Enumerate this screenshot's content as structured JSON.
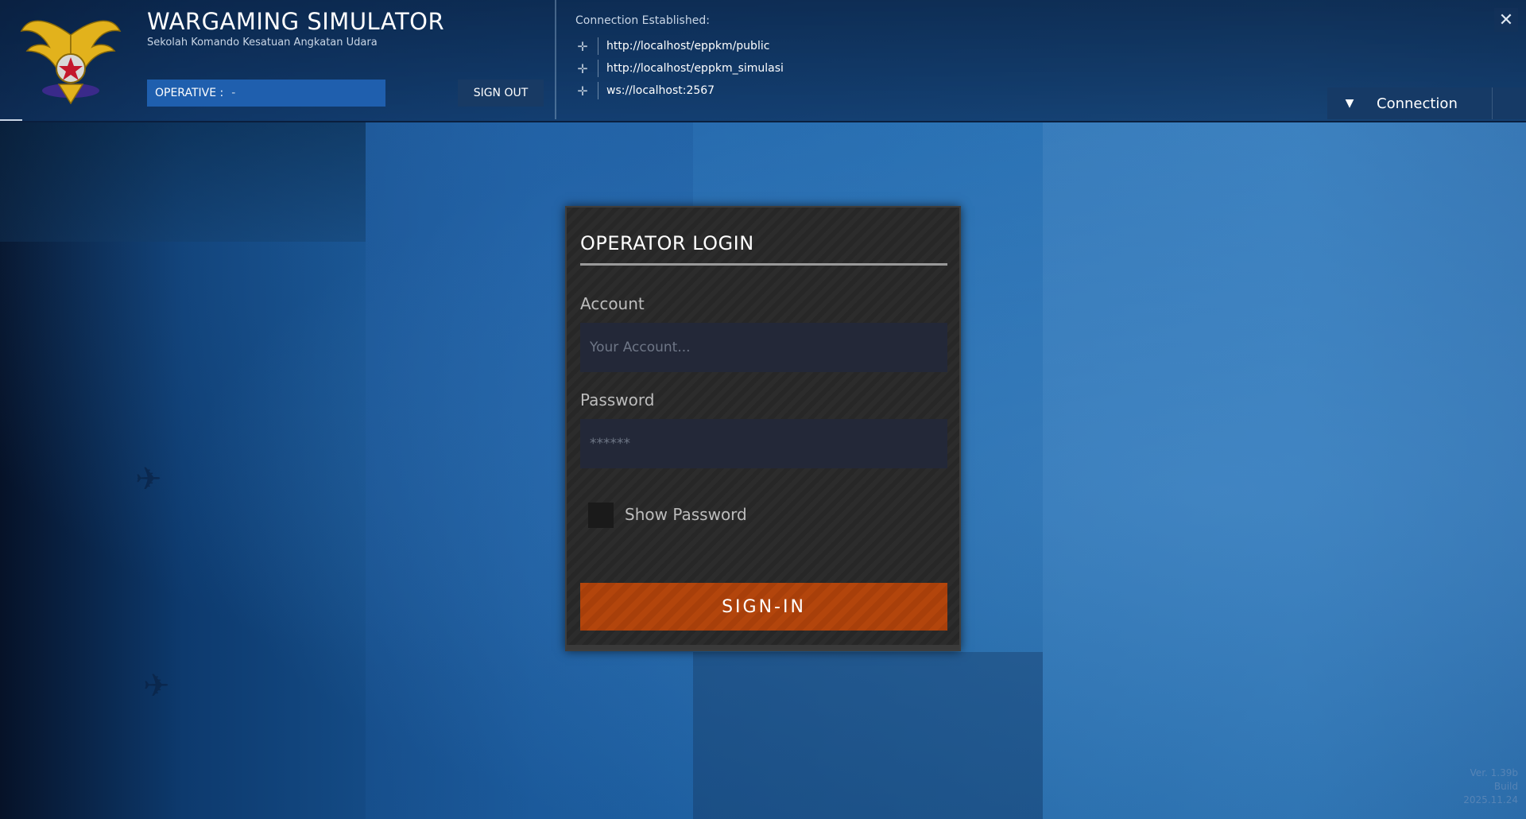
{
  "header": {
    "title": "WARGAMING SIMULATOR",
    "subtitle": "Sekolah Komando Kesatuan Angkatan Udara",
    "operative_label": "OPERATIVE :",
    "operative_value": "-",
    "signout_label": "SIGN OUT",
    "logo_icon": "eagle-emblem-icon"
  },
  "connection": {
    "status": "Connection Established:",
    "items": [
      {
        "icon": "connection-cross-icon",
        "url": "http://localhost/eppkm/public"
      },
      {
        "icon": "connection-cross-icon",
        "url": "http://localhost/eppkm_simulasi"
      },
      {
        "icon": "connection-cross-icon",
        "url": "ws://localhost:2567"
      }
    ],
    "toggle_label": "Connection"
  },
  "login": {
    "title": "OPERATOR LOGIN",
    "account_label": "Account",
    "account_placeholder": "Your Account...",
    "account_value": "",
    "password_label": "Password",
    "password_placeholder": "******",
    "password_value": "",
    "show_password_label": "Show Password",
    "show_password_checked": false,
    "signin_label": "SIGN-IN"
  },
  "version": {
    "line1": "Ver. 1.39b",
    "line2": "Build",
    "line3": "2025.11.24"
  },
  "colors": {
    "signin": "#b3450c",
    "operative_bg": "#1f5fae",
    "panel_bg": "#2c2c2c"
  }
}
